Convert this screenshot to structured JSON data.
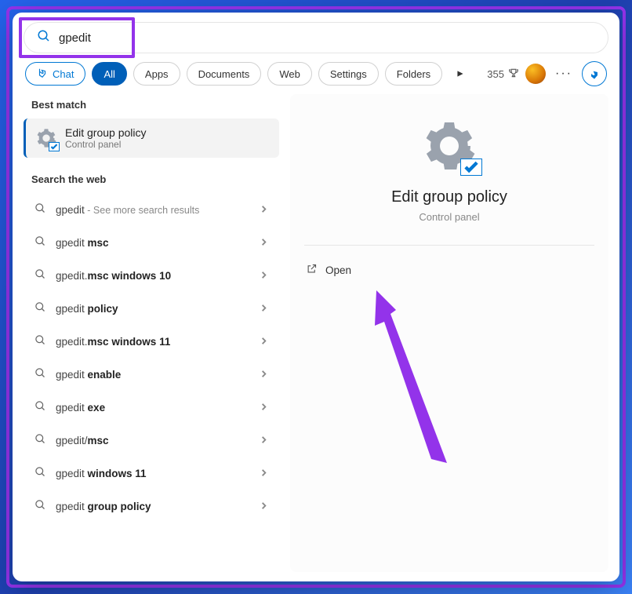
{
  "search": {
    "value": "gpedit"
  },
  "filters": {
    "chat": "Chat",
    "tabs": [
      "All",
      "Apps",
      "Documents",
      "Web",
      "Settings",
      "Folders"
    ]
  },
  "topbar": {
    "points": "355"
  },
  "left": {
    "best_match_header": "Best match",
    "best_match": {
      "title": "Edit group policy",
      "subtitle": "Control panel"
    },
    "web_header": "Search the web",
    "web_items": [
      {
        "prefix": "gpedit",
        "bold": "",
        "hint": " - See more search results"
      },
      {
        "prefix": "gpedit ",
        "bold": "msc",
        "hint": ""
      },
      {
        "prefix": "gpedit.",
        "bold": "msc windows 10",
        "hint": ""
      },
      {
        "prefix": "gpedit ",
        "bold": "policy",
        "hint": ""
      },
      {
        "prefix": "gpedit.",
        "bold": "msc windows 11",
        "hint": ""
      },
      {
        "prefix": "gpedit ",
        "bold": "enable",
        "hint": ""
      },
      {
        "prefix": "gpedit ",
        "bold": "exe",
        "hint": ""
      },
      {
        "prefix": "gpedit/",
        "bold": "msc",
        "hint": ""
      },
      {
        "prefix": "gpedit ",
        "bold": "windows 11",
        "hint": ""
      },
      {
        "prefix": "gpedit ",
        "bold": "group policy",
        "hint": ""
      }
    ]
  },
  "right": {
    "title": "Edit group policy",
    "subtitle": "Control panel",
    "open_label": "Open"
  }
}
